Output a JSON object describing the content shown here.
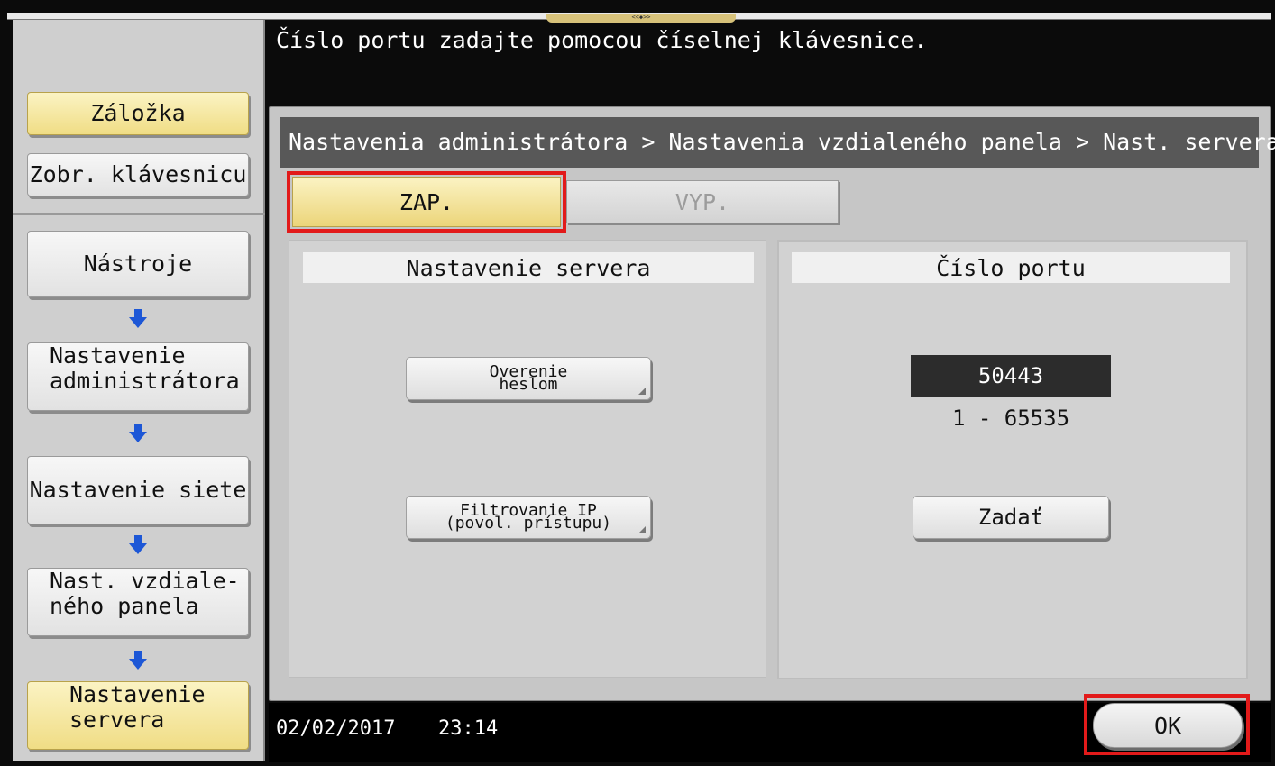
{
  "top_handle_text": "<<◆>>",
  "message": "Číslo portu zadajte pomocou číselnej klávesnice.",
  "sidebar": {
    "bookmark_label": "Záložka",
    "keyboard_label": "Zobr. klávesnicu",
    "nav": [
      {
        "label": "Nástroje"
      },
      {
        "label_line1": "Nastavenie",
        "label_line2": "administrátora"
      },
      {
        "label": "Nastavenie siete"
      },
      {
        "label_line1": "Nast. vzdiale-",
        "label_line2": "ného panela"
      },
      {
        "label_line1": "Nastavenie",
        "label_line2": "servera"
      }
    ],
    "arrow_icon": "arrow-down-icon"
  },
  "breadcrumb": "Nastavenia administrátora > Nastavenia vzdialeného panela > Nast. servera",
  "toggle": {
    "on_label": "ZAP.",
    "off_label": "VYP.",
    "selected": "ZAP."
  },
  "server_section": {
    "title": "Nastavenie servera",
    "auth_btn_line1": "Overenie",
    "auth_btn_line2": "heslom",
    "ip_btn_line1": "Filtrovanie IP",
    "ip_btn_line2": "(povol. prístupu)"
  },
  "port_section": {
    "title": "Číslo portu",
    "value": "50443",
    "range": "1 - 65535",
    "enter_label": "Zadať"
  },
  "status": {
    "date": "02/02/2017",
    "time": "23:14"
  },
  "ok_label": "OK",
  "colors": {
    "highlight": "#e21a1a",
    "selected_yellow": "#f0dd85",
    "arrow_blue": "#1d57d6"
  }
}
